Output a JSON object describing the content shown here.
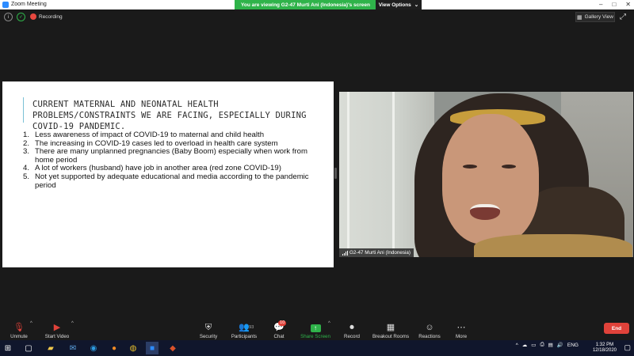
{
  "window": {
    "title": "Zoom Meeting",
    "min": "–",
    "max": "□",
    "close": "✕"
  },
  "banner": {
    "text": "You are viewing G2-47 Murti Ani (Indonesia)'s screen",
    "view_options": "View Options",
    "caret": "⌄"
  },
  "top": {
    "info_icon": "i",
    "shield_icon": "✓",
    "recording": "Recording",
    "gallery_view": "Gallery View",
    "fullscreen_icon": "⤢"
  },
  "slide": {
    "heading": "CURRENT MATERNAL AND NEONATAL HEALTH PROBLEMS/CONSTRAINTS WE ARE FACING, ESPECIALLY DURING COVID-19 PANDEMIC.",
    "items": [
      {
        "n": "1.",
        "text": "Less awareness of impact of COVID-19 to maternal and child health"
      },
      {
        "n": "2.",
        "text": "The increasing in COVID-19 cases led to overload in health care system"
      },
      {
        "n": "3.",
        "text": "There are many unplanned pregnancies (Baby Boom) especially when work from home period"
      },
      {
        "n": "4.",
        "text": "A lot of workers (husband)  have job in another area (red zone COVID-19)"
      },
      {
        "n": "5.",
        "text": "Not yet supported by adequate educational and media according to the pandemic period"
      }
    ]
  },
  "video": {
    "name": "G2-47 Murti Ani (Indonesia)"
  },
  "toolbar": {
    "unmute": "Unmute",
    "start_video": "Start Video",
    "security": "Security",
    "participants": "Participants",
    "participants_count": "93",
    "chat": "Chat",
    "chat_badge": "10",
    "share_screen": "Share Screen",
    "record": "Record",
    "breakout_rooms": "Breakout Rooms",
    "reactions": "Reactions",
    "more": "More",
    "end": "End",
    "caret": "^"
  },
  "taskbar": {
    "lang": "ENG",
    "time": "1:32 PM",
    "date": "12/18/2020",
    "tray_up": "^"
  },
  "colors": {
    "share_green": "#2fb34a",
    "end_red": "#e0423a",
    "accent_blue": "#2d8cff"
  }
}
